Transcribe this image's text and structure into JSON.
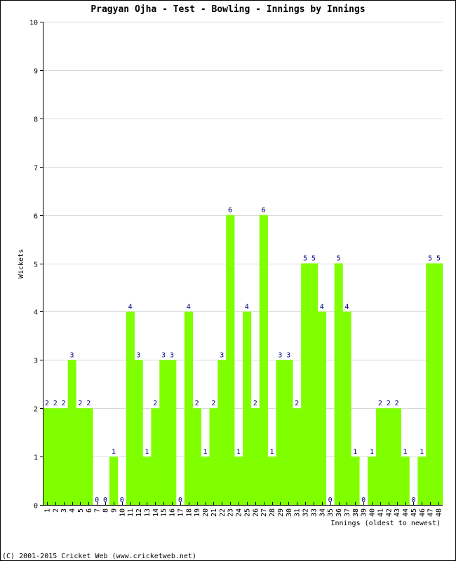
{
  "chart_data": {
    "type": "bar",
    "title": "Pragyan Ojha - Test - Bowling - Innings by Innings",
    "xlabel": "Innings (oldest to newest)",
    "ylabel": "Wickets",
    "ylim": [
      0,
      10
    ],
    "yticks": [
      "0",
      "1",
      "2",
      "3",
      "4",
      "5",
      "6",
      "7",
      "8",
      "9",
      "10"
    ],
    "grid": true,
    "bar_color": "#80ff00",
    "label_color": "#000080",
    "categories": [
      "1",
      "2",
      "3",
      "4",
      "5",
      "6",
      "7",
      "8",
      "9",
      "10",
      "11",
      "12",
      "13",
      "14",
      "15",
      "16",
      "17",
      "18",
      "19",
      "20",
      "21",
      "22",
      "23",
      "24",
      "25",
      "26",
      "27",
      "28",
      "29",
      "30",
      "31",
      "32",
      "33",
      "34",
      "35",
      "36",
      "37",
      "38",
      "39",
      "40",
      "41",
      "42",
      "43",
      "44",
      "45",
      "46",
      "47",
      "48"
    ],
    "values": [
      2,
      2,
      2,
      3,
      2,
      2,
      0,
      0,
      1,
      0,
      4,
      3,
      1,
      2,
      3,
      3,
      0,
      4,
      2,
      1,
      2,
      3,
      6,
      1,
      4,
      2,
      6,
      1,
      3,
      3,
      2,
      5,
      5,
      4,
      0,
      5,
      4,
      1,
      0,
      1,
      2,
      2,
      2,
      1,
      0,
      1,
      5,
      5
    ]
  },
  "footer": "(C) 2001-2015 Cricket Web (www.cricketweb.net)"
}
